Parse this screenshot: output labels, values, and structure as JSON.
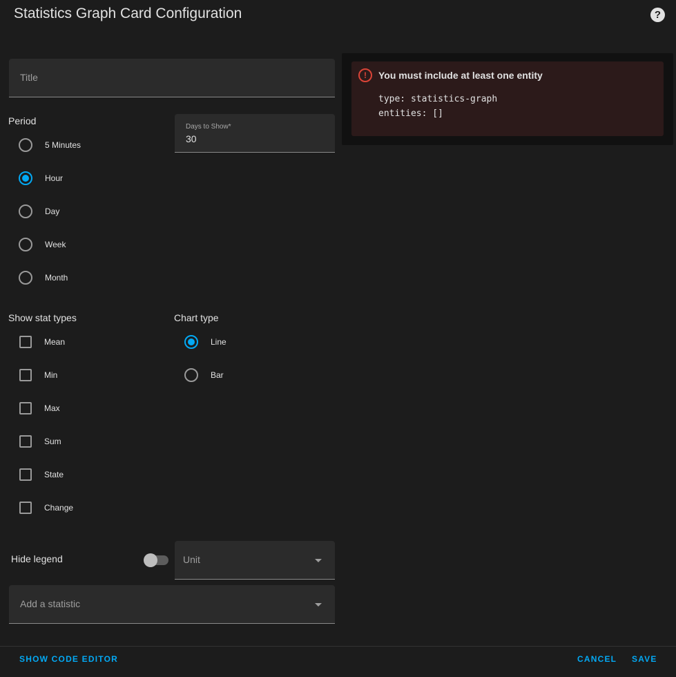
{
  "dialog": {
    "title": "Statistics Graph Card Configuration",
    "help_icon": "?"
  },
  "form": {
    "title_placeholder": "Title",
    "period": {
      "label": "Period",
      "options": [
        "5 Minutes",
        "Hour",
        "Day",
        "Week",
        "Month"
      ],
      "selected": "Hour"
    },
    "days_to_show": {
      "label": "Days to Show*",
      "value": "30"
    },
    "stat_types": {
      "label": "Show stat types",
      "options": [
        "Mean",
        "Min",
        "Max",
        "Sum",
        "State",
        "Change"
      ]
    },
    "chart_type": {
      "label": "Chart type",
      "options": [
        "Line",
        "Bar"
      ],
      "selected": "Line"
    },
    "hide_legend": {
      "label": "Hide legend",
      "enabled": false
    },
    "unit": {
      "placeholder": "Unit"
    },
    "add_statistic": {
      "placeholder": "Add a statistic"
    }
  },
  "preview": {
    "error_icon": "!",
    "error_title": "You must include at least one entity",
    "code_lines": [
      "type: statistics-graph",
      "entities: []"
    ]
  },
  "footer": {
    "show_code_editor": "Show code editor",
    "cancel": "Cancel",
    "save": "Save"
  },
  "colors": {
    "accent": "#03a9f4",
    "error": "#db4437",
    "background": "#1c1c1c"
  }
}
